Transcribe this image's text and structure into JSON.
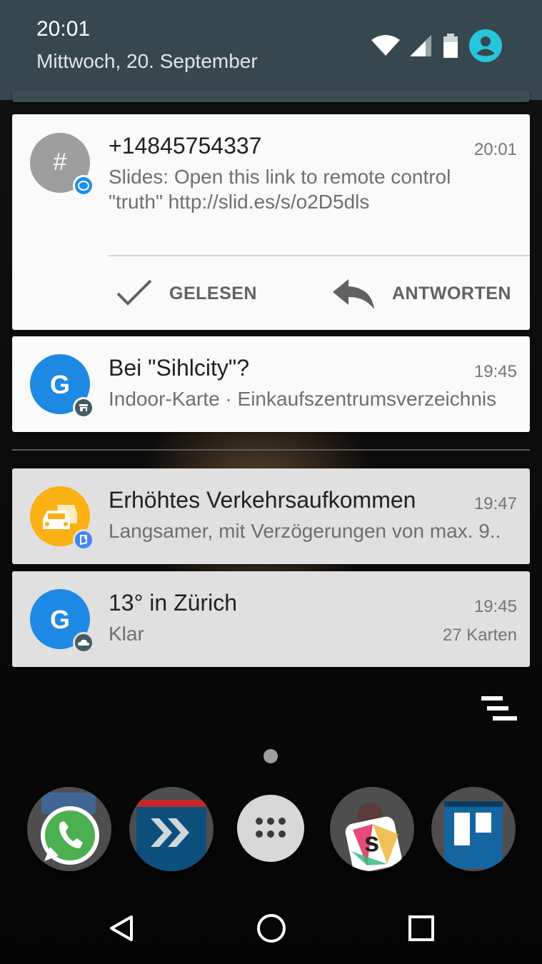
{
  "status": {
    "time": "20:01",
    "date": "Mittwoch, 20. September",
    "icons": [
      "wifi-icon",
      "cell-signal-icon",
      "battery-icon",
      "account-icon"
    ]
  },
  "notifications": [
    {
      "app": "signal",
      "avatar_letter": "#",
      "title": "+14845754337",
      "time": "20:01",
      "text_line1": "Slides: Open this link to remote control",
      "text_line2": "\"truth\" http://slid.es/s/o2D5dls",
      "actions": [
        {
          "label": "GELESEN",
          "icon": "check-icon"
        },
        {
          "label": "ANTWORTEN",
          "icon": "reply-icon"
        }
      ]
    },
    {
      "app": "google",
      "avatar_letter": "G",
      "title": "Bei \"Sihlcity\"?",
      "time": "19:45",
      "text": "Indoor-Karte · Einkaufszentrumsverzeichnis"
    },
    {
      "app": "maps",
      "title": "Erhöhtes Verkehrsaufkommen",
      "time": "19:47",
      "text": "Langsamer, mit Verzögerungen von max. 9.."
    },
    {
      "app": "google",
      "avatar_letter": "G",
      "title": "13° in Zürich",
      "time": "19:45",
      "text": "Klar",
      "extra": "27 Karten"
    }
  ],
  "dock": [
    "whatsapp-icon",
    "app-arrows-icon",
    "app-drawer-icon",
    "slack-icon",
    "trello-icon"
  ],
  "colors": {
    "shade": "#37474f",
    "google_blue": "#1e88e5",
    "maps_yellow": "#fbb013",
    "signal_blue": "#2090ea"
  }
}
